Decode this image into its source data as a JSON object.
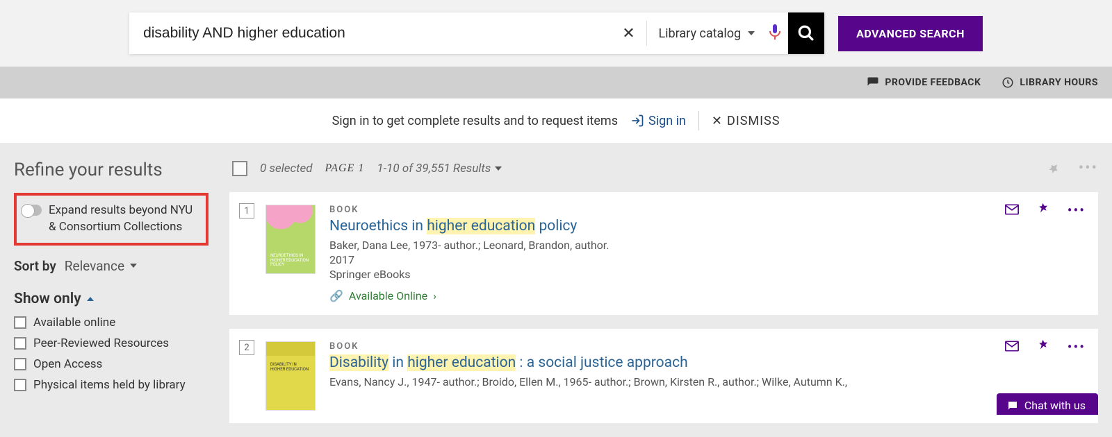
{
  "search": {
    "query": "disability AND higher education",
    "scope": "Library catalog",
    "advanced_label": "ADVANCED SEARCH"
  },
  "util": {
    "feedback": "PROVIDE FEEDBACK",
    "hours": "LIBRARY HOURS"
  },
  "signin": {
    "prompt": "Sign in to get complete results and to request items",
    "signin_label": "Sign in",
    "dismiss_label": "DISMISS"
  },
  "sidebar": {
    "refine_title": "Refine your results",
    "expand_label": "Expand results beyond NYU & Consortium Collections",
    "sort_label": "Sort by",
    "sort_value": "Relevance",
    "showonly_title": "Show only",
    "filters": [
      "Available online",
      "Peer-Reviewed Resources",
      "Open Access",
      "Physical items held by library"
    ]
  },
  "results_header": {
    "selected": "0 selected",
    "page_label": "PAGE 1",
    "range": "1-10 of 39,551 Results"
  },
  "results": [
    {
      "index": "1",
      "type": "BOOK",
      "title_pre": "Neuroethics in ",
      "title_hl": "higher education",
      "title_post": " policy",
      "authors": "Baker, Dana Lee, 1973- author.; Leonard, Brandon, author.",
      "year": "2017",
      "source": "Springer eBooks",
      "availability": "Available Online"
    },
    {
      "index": "2",
      "type": "BOOK",
      "title_pre": "",
      "title_hl": "Disability",
      "title_mid": " in ",
      "title_hl2": "higher education",
      "title_post": " : a social justice approach",
      "authors": "Evans, Nancy J., 1947- author.; Broido, Ellen M., 1965- author.; Brown, Kirsten R., author.; Wilke, Autumn K.,",
      "year": "",
      "source": "",
      "availability": ""
    }
  ],
  "chat": {
    "label": "Chat with us"
  }
}
